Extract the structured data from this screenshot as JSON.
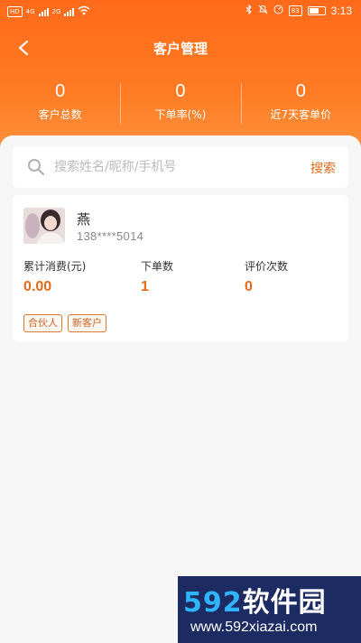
{
  "status_bar": {
    "left_badge": "HD",
    "network_1": "4G",
    "network_2": "2G",
    "battery_label": "83",
    "time": "3:13"
  },
  "nav": {
    "title": "客户管理"
  },
  "stats": [
    {
      "value": "0",
      "label": "客户总数"
    },
    {
      "value": "0",
      "label": "下单率(%)"
    },
    {
      "value": "0",
      "label": "近7天客单价"
    }
  ],
  "search": {
    "placeholder": "搜索姓名/昵称/手机号",
    "button_label": "搜索"
  },
  "customers": [
    {
      "name": "燕",
      "phone": "138****5014",
      "metrics": [
        {
          "label": "累计消费(元)",
          "value": "0.00"
        },
        {
          "label": "下单数",
          "value": "1"
        },
        {
          "label": "评价次数",
          "value": "0"
        }
      ],
      "tags": [
        "合伙人",
        "新客户"
      ]
    }
  ],
  "watermark": {
    "logo_digits": "592",
    "logo_text": "软件园",
    "url": "www.592xiazai.com"
  },
  "colors": {
    "brand_orange": "#ff6a1a",
    "accent_text": "#e46a1a"
  }
}
